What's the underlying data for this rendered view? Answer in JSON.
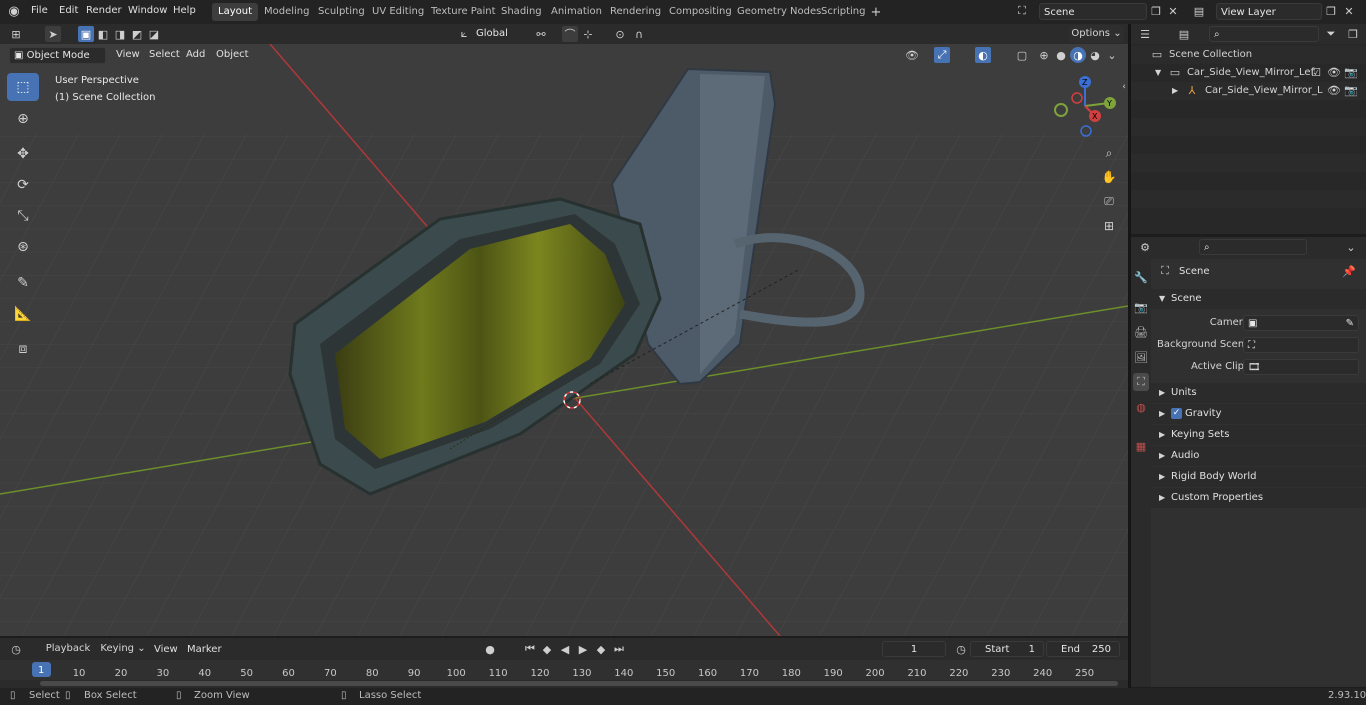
{
  "menu": [
    "File",
    "Edit",
    "Render",
    "Window",
    "Help"
  ],
  "workspaces": [
    "Layout",
    "Modeling",
    "Sculpting",
    "UV Editing",
    "Texture Paint",
    "Shading",
    "Animation",
    "Rendering",
    "Compositing",
    "Geometry Nodes",
    "Scripting"
  ],
  "active_workspace": "Layout",
  "scene_name": "Scene",
  "view_layer": "View Layer",
  "orientation": "Global",
  "options_label": "Options",
  "viewport_header": {
    "mode": "Object Mode",
    "view": "View",
    "select": "Select",
    "add": "Add",
    "object": "Object"
  },
  "viewport_overlay": {
    "perspective": "User Perspective",
    "collection": "(1) Scene Collection"
  },
  "gizmo": {
    "z": "Z",
    "y": "Y",
    "x": "X"
  },
  "outliner": {
    "root": "Scene Collection",
    "items": [
      {
        "label": "Car_Side_View_Mirror_Left_B"
      },
      {
        "label": "Car_Side_View_Mirror_Le"
      }
    ]
  },
  "properties": {
    "breadcrumb": "Scene",
    "section": "Scene",
    "camera_label": "Camera",
    "bg_scene_label": "Background Scene",
    "active_clip_label": "Active Clip",
    "panels": [
      "Units",
      "Gravity",
      "Keying Sets",
      "Audio",
      "Rigid Body World",
      "Custom Properties"
    ]
  },
  "timeline": {
    "playback": "Playback",
    "keying": "Keying",
    "view": "View",
    "marker": "Marker",
    "current_frame": "1",
    "start_label": "Start",
    "start": "1",
    "end_label": "End",
    "end": "250",
    "ticks": [
      "1",
      "10",
      "20",
      "30",
      "40",
      "50",
      "60",
      "70",
      "80",
      "90",
      "100",
      "110",
      "120",
      "130",
      "140",
      "150",
      "160",
      "170",
      "180",
      "190",
      "200",
      "210",
      "220",
      "230",
      "240",
      "250"
    ]
  },
  "statusbar": {
    "select": "Select",
    "box_select": "Box Select",
    "zoom_view": "Zoom View",
    "lasso_select": "Lasso Select",
    "version": "2.93.10"
  },
  "colors": {
    "accent": "#4772b3",
    "x_axis": "#c23a3a",
    "y_axis": "#7da33a"
  }
}
